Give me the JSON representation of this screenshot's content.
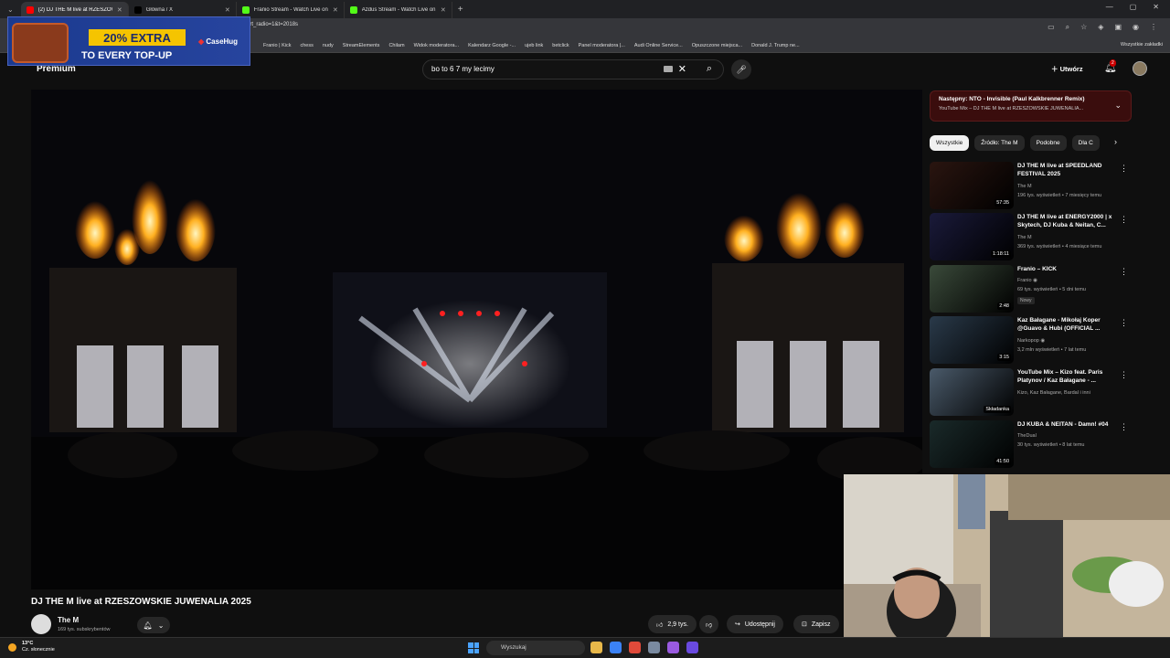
{
  "browser": {
    "tabs": [
      {
        "title": "(2) DJ THE M live at RZESZOWSKIE JUWENALIA 2025",
        "active": true,
        "fav": "#ff0000"
      },
      {
        "title": "Główna / X",
        "active": false,
        "fav": "#000000"
      },
      {
        "title": "Franio Stream - Watch Live on Kick",
        "active": false,
        "fav": "#53fc18"
      },
      {
        "title": "Azdus Stream - Watch Live on Kick",
        "active": false,
        "fav": "#53fc18"
      }
    ],
    "url": "art_radio=1&t=2018s",
    "bookmarks": [
      "Franio | Kick",
      "chess",
      "nudy",
      "StreamElements",
      "Chilam",
      "Widok moderatora...",
      "Kalendarz Google -...",
      "ujeb link",
      "betclick",
      "Panel moderatora |...",
      "Audi Online Service...",
      "Opuszczone miejsca...",
      "Donald J. Trump ne..."
    ],
    "all_bookmarks": "Wszystkie zakładki"
  },
  "ad": {
    "line1": "20% EXTRA",
    "line2": "TO EVERY TOP-UP",
    "brand": "CaseHug"
  },
  "youtube": {
    "logo": "Premium",
    "search_value": "bo to 6 7 my lecimy",
    "create_label": "Utwórz",
    "notif_count": "2"
  },
  "video": {
    "title": "DJ THE M live at RZESZOWSKIE JUWENALIA 2025",
    "channel": "The M",
    "subscribers": "169 tys. subskrybentów",
    "likes": "2,9 tys.",
    "share": "Udostępnij",
    "save": "Zapisz"
  },
  "next_up": {
    "title": "Następny: NTO - Invisible (Paul Kalkbrenner Remix)",
    "sub": "YouTube Mix – DJ THE M live at RZESZOWSKIE JUWENALIA..."
  },
  "chips": [
    "Wszystkie",
    "Źródło: The M",
    "Podobne",
    "Dla C"
  ],
  "recommendations": [
    {
      "title": "DJ THE M live at SPEEDLAND FESTIVAL 2025",
      "channel": "The M",
      "meta": "196 tys. wyświetleń • 7 miesięcy temu",
      "duration": "57:35",
      "badge": "",
      "color": "#2a1510"
    },
    {
      "title": "DJ THE M live at ENERGY2000 | x Skytech, DJ Kuba & Neitan, C...",
      "channel": "The M",
      "meta": "369 tys. wyświetleń • 4 miesiące temu",
      "duration": "1:18:11",
      "badge": "",
      "color": "#1a1a3a"
    },
    {
      "title": "Franio – KICK",
      "channel": "Franio ◉",
      "meta": "69 tys. wyświetleń • 5 dni temu",
      "duration": "2:48",
      "badge": "Nowy",
      "color": "#3a4a3a"
    },
    {
      "title": "Kaz Bałagane - Mikołaj Koper @Guavo & Hubi (OFFICIAL ...",
      "channel": "Narkopop ◉",
      "meta": "3,2 mln wyświetleń • 7 lat temu",
      "duration": "3:15",
      "badge": "",
      "color": "#2a3a4a"
    },
    {
      "title": "YouTube Mix – Kizo feat. Paris Platynov / Kaz Bałagane - ...",
      "channel": "Kizo, Kaz Bałagane, Bardal i inni",
      "meta": "",
      "duration": "Składanka",
      "badge": "",
      "color": "#4a5a6a"
    },
    {
      "title": "DJ KUBA & NEITAN - Damn! #04",
      "channel": "TheDual",
      "meta": "30 tys. wyświetleń • 8 lat temu",
      "duration": "41:50",
      "badge": "",
      "color": "#1a2a2a"
    }
  ],
  "taskbar": {
    "temp": "13°C",
    "weather": "Cz. słonecznie",
    "search": "Wyszukaj"
  }
}
